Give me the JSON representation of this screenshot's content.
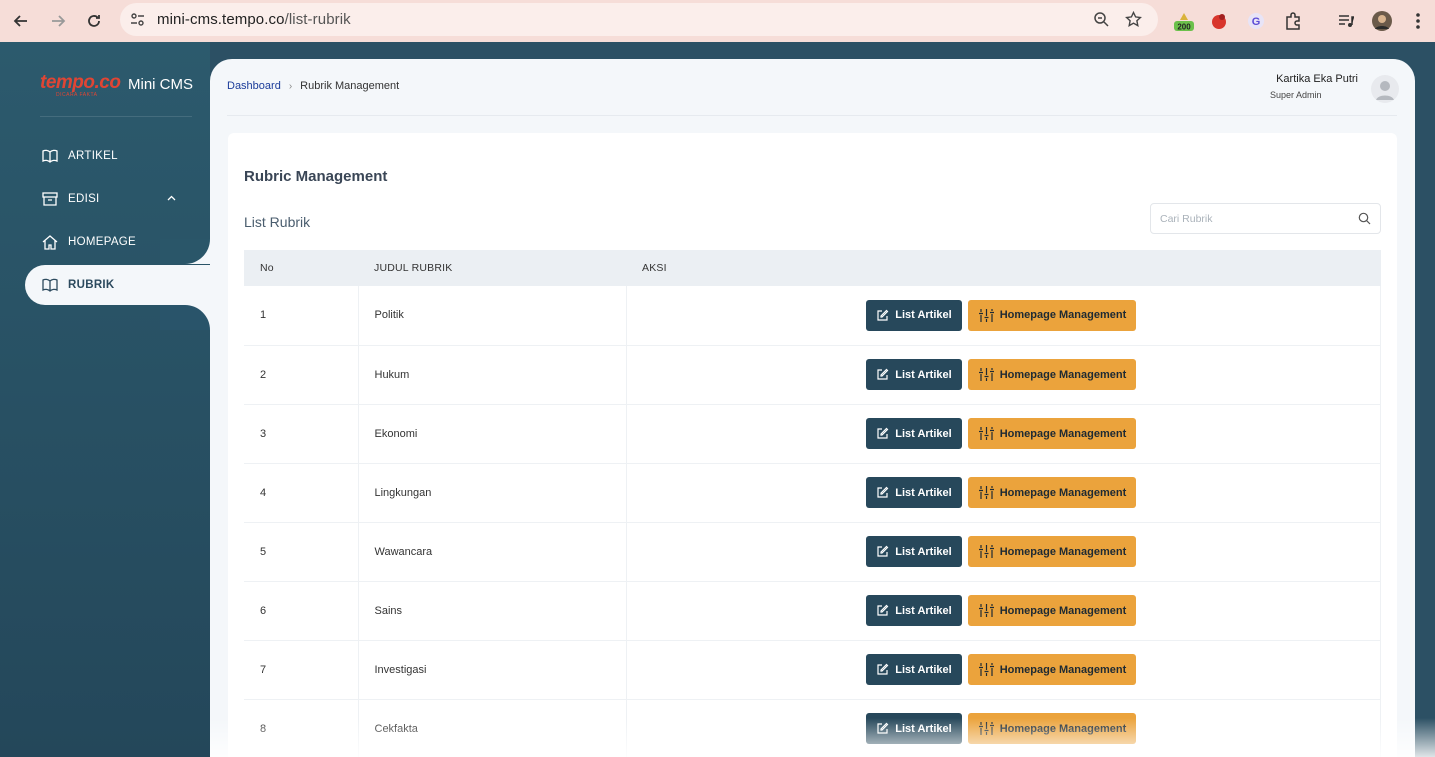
{
  "browser": {
    "url_host": "mini-cms.tempo.co",
    "url_path": "/list-rubrik",
    "extension_badge": "200"
  },
  "sidebar": {
    "logo_text": "tempo.co",
    "logo_tagline": "DICARA FAKTA",
    "app_name": "Mini CMS",
    "items": [
      {
        "label": "ARTIKEL",
        "icon": "book-open-icon"
      },
      {
        "label": "EDISI",
        "icon": "archive-box-icon"
      },
      {
        "label": "HOMEPAGE",
        "icon": "home-icon"
      },
      {
        "label": "RUBRIK",
        "icon": "book-open-icon",
        "active": true
      }
    ]
  },
  "header": {
    "breadcrumb": [
      "Dashboard",
      "Rubrik Management"
    ],
    "user_name": "Kartika Eka Putri",
    "user_role": "Super Admin"
  },
  "content": {
    "title": "Rubric Management",
    "list_title": "List Rubrik",
    "search_placeholder": "Cari Rubrik",
    "columns": [
      "No",
      "JUDUL RUBRIK",
      "AKSI"
    ],
    "rows": [
      {
        "no": "1",
        "judul": "Politik"
      },
      {
        "no": "2",
        "judul": "Hukum"
      },
      {
        "no": "3",
        "judul": "Ekonomi"
      },
      {
        "no": "4",
        "judul": "Lingkungan"
      },
      {
        "no": "5",
        "judul": "Wawancara"
      },
      {
        "no": "6",
        "judul": "Sains"
      },
      {
        "no": "7",
        "judul": "Investigasi"
      },
      {
        "no": "8",
        "judul": "Cekfakta"
      }
    ],
    "btn_list_artikel": "List Artikel",
    "btn_homepage_management": "Homepage Management"
  },
  "colors": {
    "sidebar": "#2c5064",
    "accent_dark": "#27485b",
    "accent_orange": "#eba33c",
    "logo_red": "#e04534"
  }
}
